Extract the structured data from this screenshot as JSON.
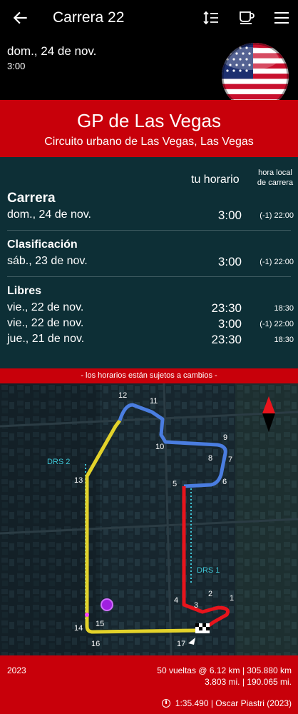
{
  "topbar": {
    "title": "Carrera 22",
    "icons": [
      "back-arrow-icon",
      "sort-icon",
      "coffee-cup-icon",
      "menu-icon"
    ]
  },
  "header": {
    "date": "dom., 24 de nov.",
    "time": "3:00",
    "flag": "usa-flag"
  },
  "race": {
    "name": "GP de Las Vegas",
    "circuit": "Circuito urbano de Las Vegas, Las Vegas"
  },
  "schedule": {
    "col_your": "tu horario",
    "col_local_line1": "hora local",
    "col_local_line2": "de carrera",
    "sessions": [
      {
        "name": "Carrera",
        "rows": [
          {
            "date": "dom., 24 de nov.",
            "your": "3:00",
            "local": "(-1) 22:00"
          }
        ]
      },
      {
        "name": "Clasificación",
        "rows": [
          {
            "date": "sáb., 23 de nov.",
            "your": "3:00",
            "local": "(-1) 22:00"
          }
        ]
      },
      {
        "name": "Libres",
        "rows": [
          {
            "date": "vie., 22 de nov.",
            "your": "23:30",
            "local": "18:30"
          },
          {
            "date": "vie., 22 de nov.",
            "your": "3:00",
            "local": "(-1) 22:00"
          },
          {
            "date": "jue., 21 de nov.",
            "your": "23:30",
            "local": "18:30"
          }
        ]
      }
    ]
  },
  "notice": "- los horarios están sujetos a cambios -",
  "map": {
    "drs": [
      "DRS 2",
      "DRS 1"
    ],
    "turns": [
      "1",
      "2",
      "3",
      "4",
      "5",
      "6",
      "7",
      "8",
      "9",
      "10",
      "11",
      "12",
      "13",
      "14",
      "15",
      "16",
      "17"
    ],
    "colors": {
      "sector1": "#e8141c",
      "sector2": "#4a7de0",
      "sector3": "#e3d22a",
      "drs": "#3fc6d6"
    }
  },
  "footer": {
    "year": "2023",
    "laps": "50 vueltas @ 6.12 km | 305.880 km",
    "miles": "3.803 mi. | 190.065 mi.",
    "record": "1:35.490 | Oscar Piastri (2023)"
  },
  "colors": {
    "accent": "#c8000a",
    "panel": "#0d2f36"
  }
}
